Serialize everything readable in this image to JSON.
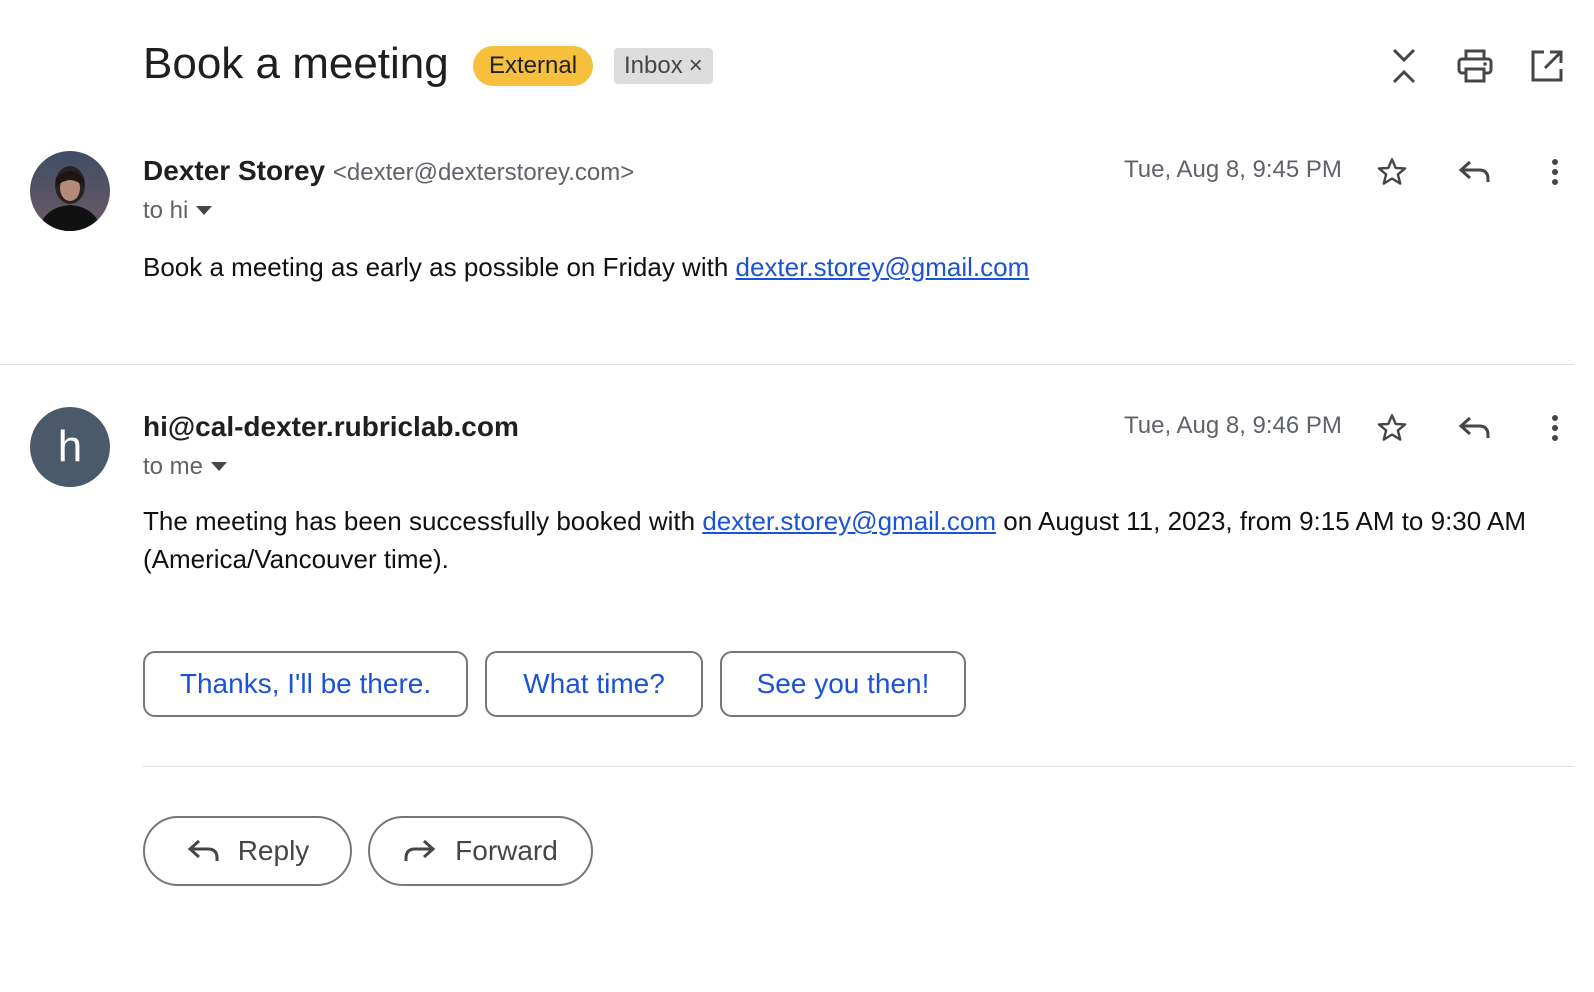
{
  "thread": {
    "subject": "Book a meeting",
    "labels": [
      {
        "text": "External",
        "color": "#f6bf3c"
      },
      {
        "text": "Inbox",
        "removable_glyph": "×",
        "color": "#dddddd"
      }
    ],
    "toolbar_icons": [
      "collapse-all-icon",
      "print-icon",
      "open-in-new-window-icon"
    ]
  },
  "messages": [
    {
      "sender_name": "Dexter Storey",
      "sender_email": "<dexter@dexterstorey.com>",
      "to": "to hi",
      "date": "Tue, Aug 8, 9:45 PM",
      "body_prefix": "Book a meeting as early as possible on Friday with ",
      "body_link": "dexter.storey@gmail.com",
      "body_suffix": "",
      "avatar": "photo"
    },
    {
      "sender_name": "hi@cal-dexter.rubriclab.com",
      "sender_email": "",
      "to": "to me",
      "date": "Tue, Aug 8, 9:46 PM",
      "body_prefix": "The meeting has been successfully booked with ",
      "body_link": "dexter.storey@gmail.com",
      "body_suffix": " on August 11, 2023, from 9:15 AM to 9:30 AM (America/Vancouver time).",
      "avatar_letter": "h"
    }
  ],
  "smart_replies": [
    "Thanks, I'll be there.",
    "What time?",
    "See you then!"
  ],
  "actions": {
    "reply": "Reply",
    "forward": "Forward"
  },
  "colors": {
    "link": "#1a53d6",
    "external_label": "#f6bf3c",
    "avatar_letter_bg": "#4a5a6a"
  }
}
